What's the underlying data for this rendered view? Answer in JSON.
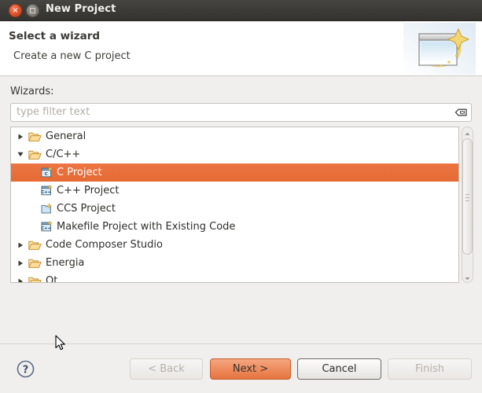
{
  "window": {
    "title": "New Project",
    "close_button_label": "×",
    "maximize_button_label": ""
  },
  "header": {
    "title": "Select a wizard",
    "description": "Create a new C project",
    "icon": "wizard-window-sparkle-icon"
  },
  "wizards": {
    "label": "Wizards:",
    "filter": {
      "value": "",
      "placeholder": "type filter text",
      "clear_icon": "clear-field-icon"
    },
    "tree": [
      {
        "label": "General",
        "depth": 0,
        "icon": "folder-icon",
        "expander": "collapsed",
        "selected": false
      },
      {
        "label": "C/C++",
        "depth": 0,
        "icon": "folder-icon",
        "expander": "expanded",
        "selected": false
      },
      {
        "label": "C Project",
        "depth": 1,
        "icon": "c-project-icon",
        "expander": "none",
        "selected": true
      },
      {
        "label": "C++ Project",
        "depth": 1,
        "icon": "cpp-project-icon",
        "expander": "none",
        "selected": false
      },
      {
        "label": "CCS Project",
        "depth": 1,
        "icon": "ccs-project-icon",
        "expander": "none",
        "selected": false
      },
      {
        "label": "Makefile Project with Existing Code",
        "depth": 1,
        "icon": "cpp-project-icon",
        "expander": "none",
        "selected": false
      },
      {
        "label": "Code Composer Studio",
        "depth": 0,
        "icon": "folder-icon",
        "expander": "collapsed",
        "selected": false
      },
      {
        "label": "Energia",
        "depth": 0,
        "icon": "folder-icon",
        "expander": "collapsed",
        "selected": false
      },
      {
        "label": "Qt",
        "depth": 0,
        "icon": "folder-icon",
        "expander": "collapsed",
        "selected": false
      }
    ],
    "scrollbar": {
      "up_arrow": "scroll-up-arrow-icon",
      "down_arrow": "scroll-down-arrow-icon"
    }
  },
  "buttons": {
    "help": "help-question-icon",
    "back": {
      "label": "< Back",
      "enabled": false
    },
    "next": {
      "label": "Next >",
      "enabled": true
    },
    "cancel": {
      "label": "Cancel",
      "enabled": true
    },
    "finish": {
      "label": "Finish",
      "enabled": false
    }
  },
  "colors": {
    "titlebar": "#3b3a36",
    "selection": "#e56a33",
    "primary_button": "#ee8d5f",
    "dialog_background": "#f1efee",
    "panel_background": "#ffffff"
  }
}
